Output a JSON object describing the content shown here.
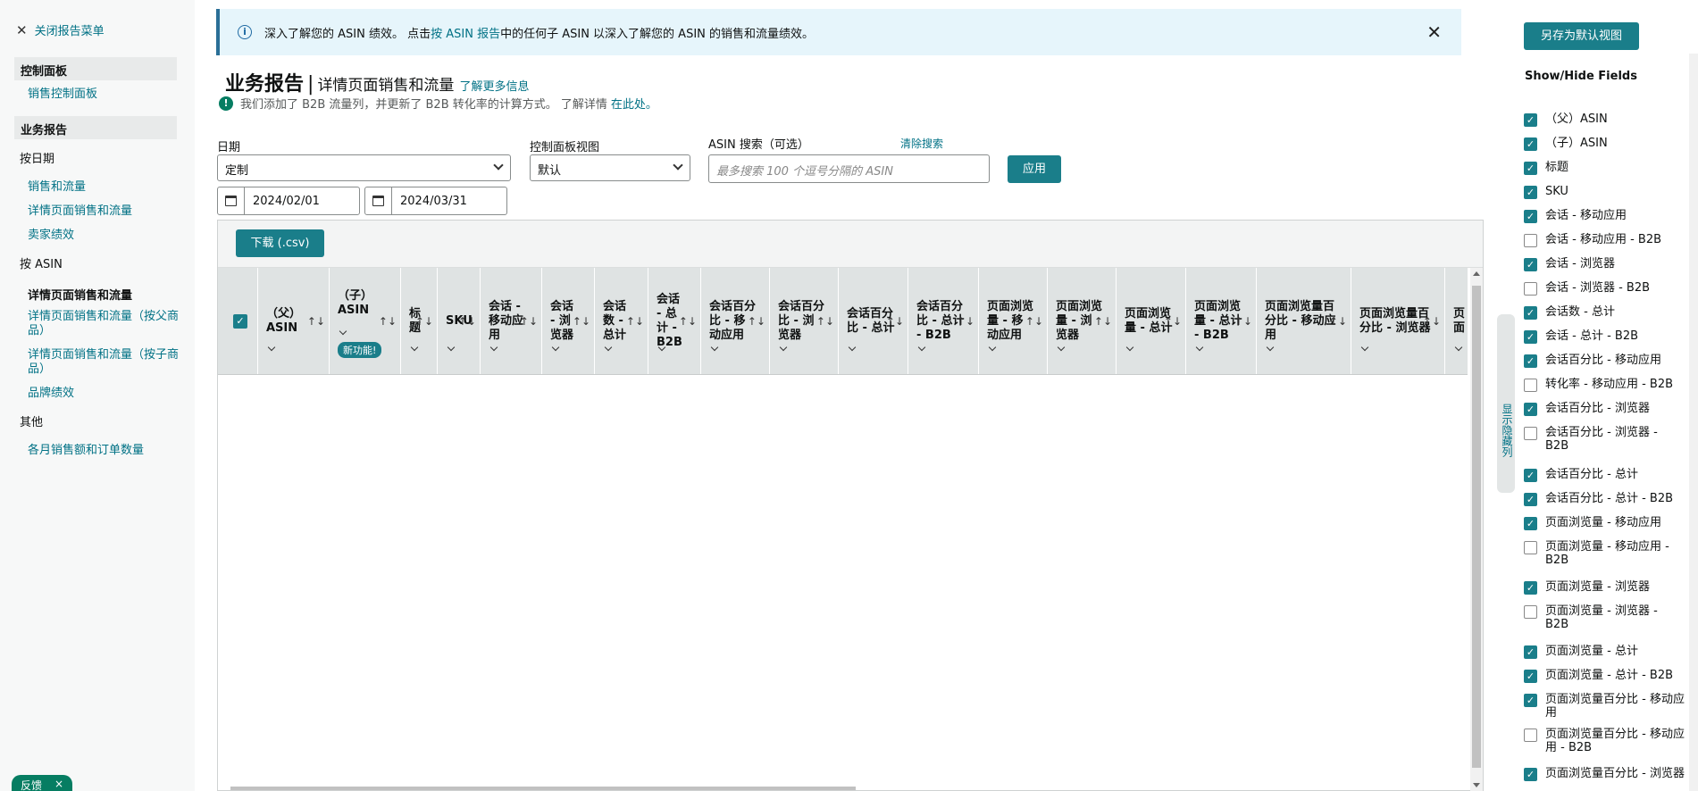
{
  "sidebar": {
    "close_menu": "关闭报告菜单",
    "sec_dashboard": "控制面板",
    "sales_dashboard": "销售控制面板",
    "sec_business": "业务报告",
    "by_date": "按日期",
    "sales_traffic": "销售和流量",
    "detail_sales_traffic": "详情页面销售和流量",
    "seller_perf": "卖家绩效",
    "by_asin": "按 ASIN",
    "detail_active": "详情页面销售和流量",
    "detail_parent": "详情页面销售和流量（按父商品）",
    "detail_child": "详情页面销售和流量（按子商品）",
    "brand_perf": "品牌绩效",
    "other": "其他",
    "monthly": "各月销售额和订单数量",
    "feedback": "反馈",
    "feedback_close": "×"
  },
  "banner": {
    "text_1": "深入了解您的 ASIN 绩效。 点击",
    "link": "按 ASIN 报告",
    "text_2": "中的任何子 ASIN 以深入了解您的 ASIN 的销售和流量绩效。",
    "close": "✕"
  },
  "header": {
    "title": "业务报告",
    "sep": "|",
    "subtitle": "详情页面销售和流量",
    "learn_more": "了解更多信息",
    "notice": "我们添加了 B2B 流量列，并更新了 B2B 转化率的计算方式。 了解详情",
    "notice_link": "在此处。"
  },
  "filters": {
    "date_label": "日期",
    "date_value": "定制",
    "view_label": "控制面板视图",
    "view_value": "默认",
    "asin_label": "ASIN 搜索（可选）",
    "clear_search": "清除搜索",
    "asin_placeholder": "最多搜索 100 个逗号分隔的 ASIN",
    "apply": "应用",
    "start_date": "2024/02/01",
    "end_date": "2024/03/31"
  },
  "table": {
    "download": "下载 (.csv)",
    "new_badge": "新功能!",
    "sort_glyph": "↑↓",
    "columns": [
      "（父）ASIN",
      "（子）ASIN",
      "标题",
      "SKU",
      "会话 - 移动应用",
      "会话 - 浏览器",
      "会话数 - 总计",
      "会话 - 总计 - B2B",
      "会话百分比 - 移动应用",
      "会话百分比 - 浏览器",
      "会话百分比 - 总计",
      "会话百分比 - 总计 - B2B",
      "页面浏览量 - 移动应用",
      "页面浏览量 - 浏览器",
      "页面浏览量 - 总计",
      "页面浏览量 - 总计 - B2B",
      "页面浏览量百分比 - 移动应用",
      "页面浏览量百分比 - 浏览器",
      "页面"
    ]
  },
  "handle": "显示隐藏列",
  "right": {
    "save_default": "另存为默认视图",
    "title": "Show/Hide Fields",
    "fields": [
      {
        "label": "（父）ASIN",
        "checked": true
      },
      {
        "label": "（子）ASIN",
        "checked": true
      },
      {
        "label": "标题",
        "checked": true
      },
      {
        "label": "SKU",
        "checked": true
      },
      {
        "label": "会话 - 移动应用",
        "checked": true
      },
      {
        "label": "会话 - 移动应用 - B2B",
        "checked": false
      },
      {
        "label": "会话 - 浏览器",
        "checked": true
      },
      {
        "label": "会话 - 浏览器 - B2B",
        "checked": false
      },
      {
        "label": "会话数 - 总计",
        "checked": true
      },
      {
        "label": "会话 - 总计 - B2B",
        "checked": true
      },
      {
        "label": "会话百分比 - 移动应用",
        "checked": true
      },
      {
        "label": "转化率 - 移动应用 - B2B",
        "checked": false
      },
      {
        "label": "会话百分比 - 浏览器",
        "checked": true
      },
      {
        "label": "会话百分比 - 浏览器 - B2B",
        "checked": false
      },
      {
        "label": "会话百分比 - 总计",
        "checked": true
      },
      {
        "label": "会话百分比 - 总计 - B2B",
        "checked": true
      },
      {
        "label": "页面浏览量 - 移动应用",
        "checked": true
      },
      {
        "label": "页面浏览量 - 移动应用 - B2B",
        "checked": false
      },
      {
        "label": "页面浏览量 - 浏览器",
        "checked": true
      },
      {
        "label": "页面浏览量 - 浏览器 - B2B",
        "checked": false
      },
      {
        "label": "页面浏览量 - 总计",
        "checked": true
      },
      {
        "label": "页面浏览量 - 总计 - B2B",
        "checked": true
      },
      {
        "label": "页面浏览量百分比 - 移动应用",
        "checked": true
      },
      {
        "label": "页面浏览量百分比 - 移动应用 - B2B",
        "checked": false
      },
      {
        "label": "页面浏览量百分比 - 浏览器",
        "checked": true
      }
    ]
  }
}
